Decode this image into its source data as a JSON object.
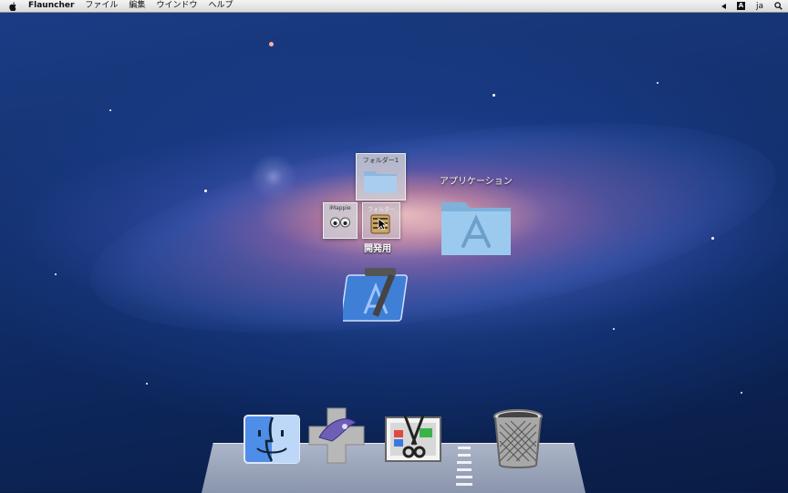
{
  "menubar": {
    "app_name": "Flauncher",
    "items": [
      "ファイル",
      "編集",
      "ウインドウ",
      "ヘルプ"
    ],
    "input_indicator": "A",
    "language": "ja"
  },
  "launcher": {
    "folder1_label": "フォルダー1",
    "imappie_label": "iMappie",
    "folder2_label": "フォルダー",
    "dev_group_label": "開発用",
    "applications_label": "アプリケーション"
  },
  "dock": {
    "items": [
      "finder-icon",
      "game-controller-icon",
      "screenshot-tool-icon",
      "trash-icon"
    ]
  },
  "colors": {
    "menubar_bg": "#e6e6e6",
    "folder_blue": "#8fc0e6",
    "xcode_blue": "#3f7fd6"
  }
}
